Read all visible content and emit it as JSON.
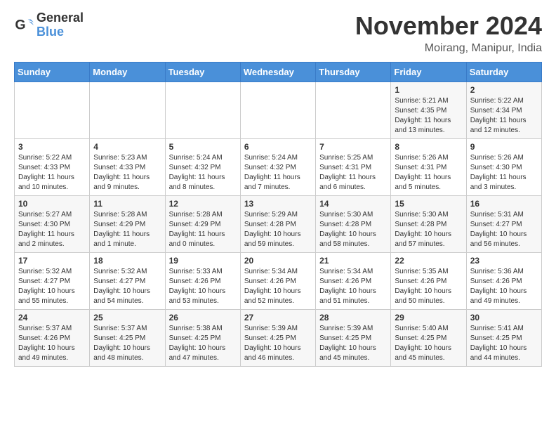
{
  "logo": {
    "general": "General",
    "blue": "Blue"
  },
  "header": {
    "month": "November 2024",
    "location": "Moirang, Manipur, India"
  },
  "weekdays": [
    "Sunday",
    "Monday",
    "Tuesday",
    "Wednesday",
    "Thursday",
    "Friday",
    "Saturday"
  ],
  "weeks": [
    [
      {
        "day": "",
        "info": ""
      },
      {
        "day": "",
        "info": ""
      },
      {
        "day": "",
        "info": ""
      },
      {
        "day": "",
        "info": ""
      },
      {
        "day": "",
        "info": ""
      },
      {
        "day": "1",
        "info": "Sunrise: 5:21 AM\nSunset: 4:35 PM\nDaylight: 11 hours and 13 minutes."
      },
      {
        "day": "2",
        "info": "Sunrise: 5:22 AM\nSunset: 4:34 PM\nDaylight: 11 hours and 12 minutes."
      }
    ],
    [
      {
        "day": "3",
        "info": "Sunrise: 5:22 AM\nSunset: 4:33 PM\nDaylight: 11 hours and 10 minutes."
      },
      {
        "day": "4",
        "info": "Sunrise: 5:23 AM\nSunset: 4:33 PM\nDaylight: 11 hours and 9 minutes."
      },
      {
        "day": "5",
        "info": "Sunrise: 5:24 AM\nSunset: 4:32 PM\nDaylight: 11 hours and 8 minutes."
      },
      {
        "day": "6",
        "info": "Sunrise: 5:24 AM\nSunset: 4:32 PM\nDaylight: 11 hours and 7 minutes."
      },
      {
        "day": "7",
        "info": "Sunrise: 5:25 AM\nSunset: 4:31 PM\nDaylight: 11 hours and 6 minutes."
      },
      {
        "day": "8",
        "info": "Sunrise: 5:26 AM\nSunset: 4:31 PM\nDaylight: 11 hours and 5 minutes."
      },
      {
        "day": "9",
        "info": "Sunrise: 5:26 AM\nSunset: 4:30 PM\nDaylight: 11 hours and 3 minutes."
      }
    ],
    [
      {
        "day": "10",
        "info": "Sunrise: 5:27 AM\nSunset: 4:30 PM\nDaylight: 11 hours and 2 minutes."
      },
      {
        "day": "11",
        "info": "Sunrise: 5:28 AM\nSunset: 4:29 PM\nDaylight: 11 hours and 1 minute."
      },
      {
        "day": "12",
        "info": "Sunrise: 5:28 AM\nSunset: 4:29 PM\nDaylight: 11 hours and 0 minutes."
      },
      {
        "day": "13",
        "info": "Sunrise: 5:29 AM\nSunset: 4:28 PM\nDaylight: 10 hours and 59 minutes."
      },
      {
        "day": "14",
        "info": "Sunrise: 5:30 AM\nSunset: 4:28 PM\nDaylight: 10 hours and 58 minutes."
      },
      {
        "day": "15",
        "info": "Sunrise: 5:30 AM\nSunset: 4:28 PM\nDaylight: 10 hours and 57 minutes."
      },
      {
        "day": "16",
        "info": "Sunrise: 5:31 AM\nSunset: 4:27 PM\nDaylight: 10 hours and 56 minutes."
      }
    ],
    [
      {
        "day": "17",
        "info": "Sunrise: 5:32 AM\nSunset: 4:27 PM\nDaylight: 10 hours and 55 minutes."
      },
      {
        "day": "18",
        "info": "Sunrise: 5:32 AM\nSunset: 4:27 PM\nDaylight: 10 hours and 54 minutes."
      },
      {
        "day": "19",
        "info": "Sunrise: 5:33 AM\nSunset: 4:26 PM\nDaylight: 10 hours and 53 minutes."
      },
      {
        "day": "20",
        "info": "Sunrise: 5:34 AM\nSunset: 4:26 PM\nDaylight: 10 hours and 52 minutes."
      },
      {
        "day": "21",
        "info": "Sunrise: 5:34 AM\nSunset: 4:26 PM\nDaylight: 10 hours and 51 minutes."
      },
      {
        "day": "22",
        "info": "Sunrise: 5:35 AM\nSunset: 4:26 PM\nDaylight: 10 hours and 50 minutes."
      },
      {
        "day": "23",
        "info": "Sunrise: 5:36 AM\nSunset: 4:26 PM\nDaylight: 10 hours and 49 minutes."
      }
    ],
    [
      {
        "day": "24",
        "info": "Sunrise: 5:37 AM\nSunset: 4:26 PM\nDaylight: 10 hours and 49 minutes."
      },
      {
        "day": "25",
        "info": "Sunrise: 5:37 AM\nSunset: 4:25 PM\nDaylight: 10 hours and 48 minutes."
      },
      {
        "day": "26",
        "info": "Sunrise: 5:38 AM\nSunset: 4:25 PM\nDaylight: 10 hours and 47 minutes."
      },
      {
        "day": "27",
        "info": "Sunrise: 5:39 AM\nSunset: 4:25 PM\nDaylight: 10 hours and 46 minutes."
      },
      {
        "day": "28",
        "info": "Sunrise: 5:39 AM\nSunset: 4:25 PM\nDaylight: 10 hours and 45 minutes."
      },
      {
        "day": "29",
        "info": "Sunrise: 5:40 AM\nSunset: 4:25 PM\nDaylight: 10 hours and 45 minutes."
      },
      {
        "day": "30",
        "info": "Sunrise: 5:41 AM\nSunset: 4:25 PM\nDaylight: 10 hours and 44 minutes."
      }
    ]
  ]
}
